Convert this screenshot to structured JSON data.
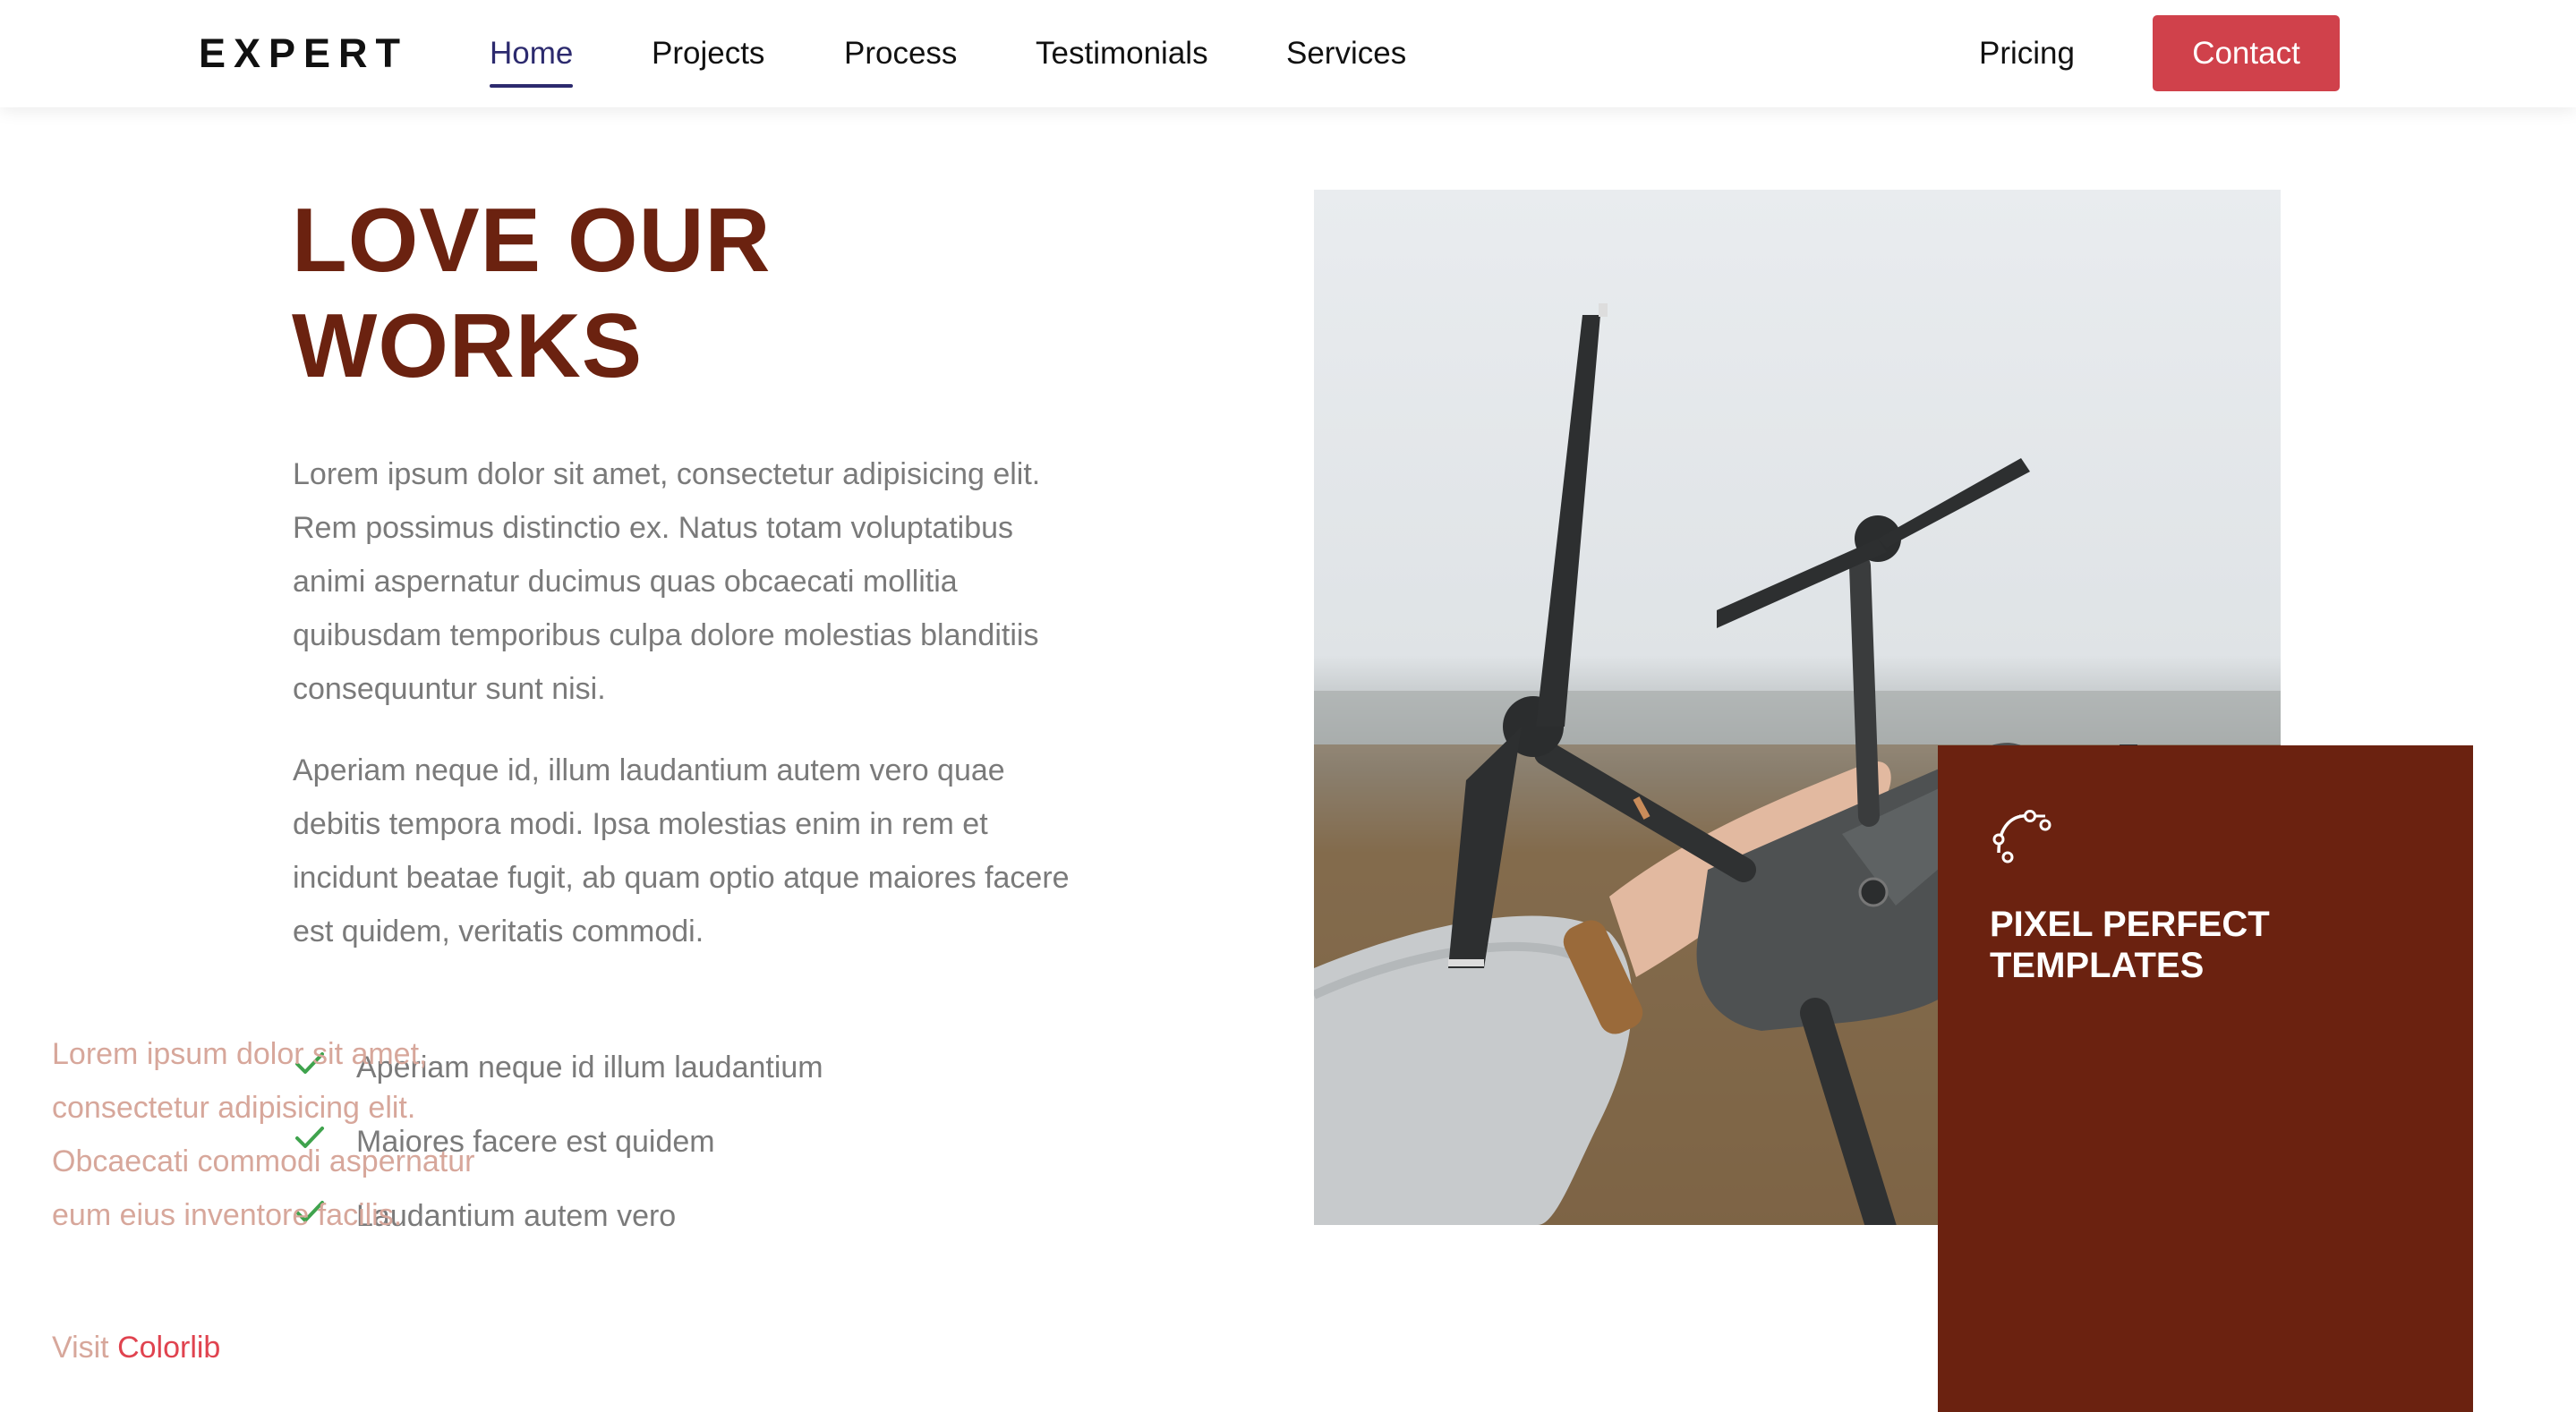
{
  "brand": {
    "logo": "EXPERT"
  },
  "nav": {
    "items": [
      {
        "label": "Home",
        "active": true
      },
      {
        "label": "Projects"
      },
      {
        "label": "Process"
      },
      {
        "label": "Testimonials"
      },
      {
        "label": "Services"
      }
    ],
    "right": {
      "pricing_label": "Pricing",
      "contact_label": "Contact"
    }
  },
  "hero": {
    "title_line1": "LOVE OUR",
    "title_line2": "WORKS",
    "paragraphs": [
      "Lorem ipsum dolor sit amet, consectetur adipisicing elit. Rem possimus distinctio ex. Natus totam voluptatibus animi aspernatur ducimus quas obcaecati mollitia quibusdam temporibus culpa dolore molestias blanditiis consequuntur sunt nisi.",
      "Aperiam neque id, illum laudantium autem vero quae debitis tempora modi. Ipsa molestias enim in rem et incidunt beatae fugit, ab quam optio atque maiores facere est quidem, veritatis commodi."
    ],
    "checklist": [
      "Aperiam neque id illum laudantium",
      "Maiores facere est quidem",
      "Laudantium autem vero"
    ]
  },
  "feature": {
    "icon": "bezier-curve-icon",
    "title": "PIXEL PERFECT TEMPLATES",
    "text": "Lorem ipsum dolor sit amet, consectetur adipisicing elit. Obcaecati commodi aspernatur eum eius inventore facilis.",
    "link_prefix": "Visit",
    "link_label": "Colorlib"
  },
  "colors": {
    "brand_dark_red": "#6b2210",
    "contact_button": "#d0414b",
    "nav_active": "#2c2a6e",
    "check_green": "#3fa34d",
    "link_red": "#e0434f"
  }
}
